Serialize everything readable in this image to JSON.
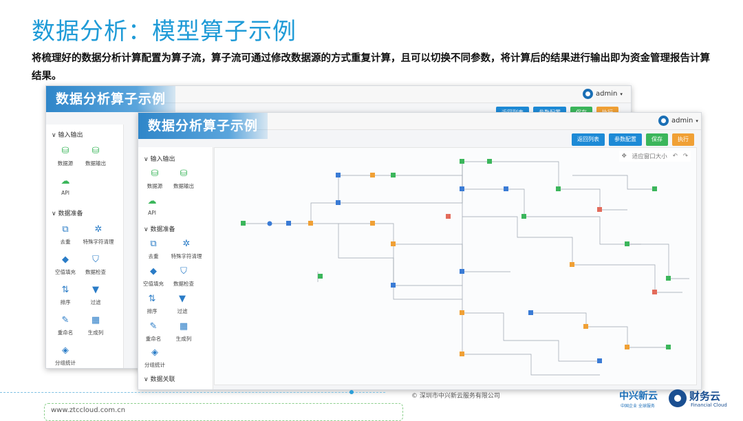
{
  "page": {
    "title": "数据分析：模型算子示例",
    "description": "将梳理好的数据分析计算配置为算子流，算子流可通过修改数据源的方式重复计算，且可以切换不同参数，将计算后的结果进行输出即为资金管理报告计算结果。"
  },
  "back_window": {
    "banner": "数据分析算子示例",
    "user": "admin",
    "buttons": [
      "返回列表",
      "参数配置",
      "保存",
      "执行"
    ],
    "sections": [
      {
        "label": "输入输出",
        "tools": [
          "数据源",
          "数据输出",
          "API"
        ]
      },
      {
        "label": "数据准备",
        "tools": [
          "去重",
          "特殊字符清理",
          "空值填充",
          "数据检查",
          "排序",
          "过滤",
          "重命名",
          "生成列",
          "分组统计"
        ]
      }
    ]
  },
  "front_window": {
    "banner": "数据分析算子示例",
    "user": "admin",
    "buttons": [
      "返回列表",
      "参数配置",
      "保存",
      "执行"
    ],
    "canvas_toolbar": {
      "fit_label": "适应窗口大小"
    },
    "sections": [
      {
        "label": "输入输出",
        "tools": [
          "数据源",
          "数据输出",
          "API"
        ]
      },
      {
        "label": "数据准备",
        "tools": [
          "去重",
          "特殊字符清理",
          "空值填充",
          "数据检查",
          "排序",
          "过滤",
          "重命名",
          "生成列",
          "分组统计"
        ]
      },
      {
        "label": "数据关联",
        "tools": []
      }
    ]
  },
  "watermark": "财务云",
  "footer": {
    "copyright": "© 深圳市中兴新云服务有限公司",
    "url": "www.ztccloud.com.cn",
    "brand1": "中兴新云",
    "brand1_sub": "中国企业 全球服务",
    "brand2": "财务云",
    "brand2_sub": "Financial Cloud"
  },
  "colors": {
    "accent": "#1f9bd7",
    "node_blue": "#3a7bd5",
    "node_orange": "#f0a035",
    "node_green": "#3bb65b",
    "node_red": "#e36b5b"
  }
}
